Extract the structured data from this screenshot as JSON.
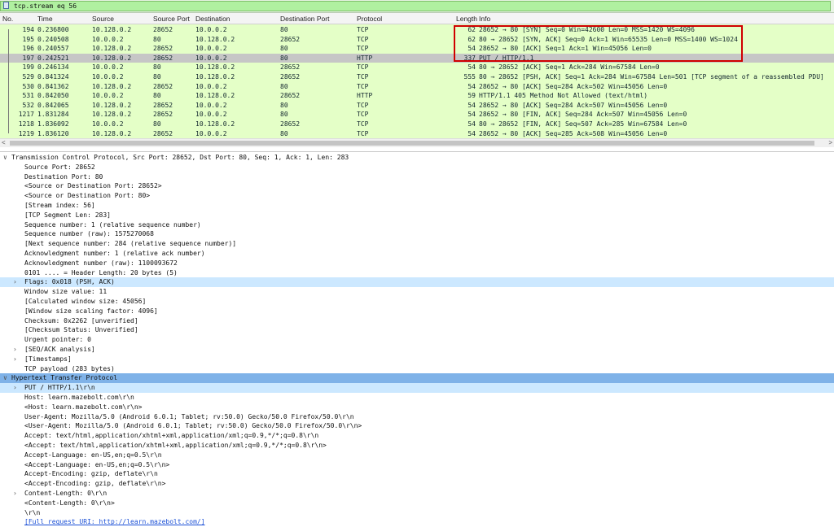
{
  "filter": {
    "value": "tcp.stream eq 56"
  },
  "columns": [
    "No.",
    "Time",
    "Source",
    "Source Port",
    "Destination",
    "Destination Port",
    "Protocol",
    "Length",
    "Info"
  ],
  "packets": [
    {
      "no": "194",
      "time": "0.236800",
      "src": "10.128.0.2",
      "sport": "28652",
      "dst": "10.0.0.2",
      "dport": "80",
      "proto": "TCP",
      "len": "62",
      "info": "28652 → 80 [SYN] Seq=0 Win=42600 Len=0 MSS=1420 WS=4096"
    },
    {
      "no": "195",
      "time": "0.240508",
      "src": "10.0.0.2",
      "sport": "80",
      "dst": "10.128.0.2",
      "dport": "28652",
      "proto": "TCP",
      "len": "62",
      "info": "80 → 28652 [SYN, ACK] Seq=0 Ack=1 Win=65535 Len=0 MSS=1400 WS=1024"
    },
    {
      "no": "196",
      "time": "0.240557",
      "src": "10.128.0.2",
      "sport": "28652",
      "dst": "10.0.0.2",
      "dport": "80",
      "proto": "TCP",
      "len": "54",
      "info": "28652 → 80 [ACK] Seq=1 Ack=1 Win=45056 Len=0"
    },
    {
      "no": "197",
      "time": "0.242521",
      "src": "10.128.0.2",
      "sport": "28652",
      "dst": "10.0.0.2",
      "dport": "80",
      "proto": "HTTP",
      "len": "337",
      "info": "PUT / HTTP/1.1"
    },
    {
      "no": "199",
      "time": "0.246134",
      "src": "10.0.0.2",
      "sport": "80",
      "dst": "10.128.0.2",
      "dport": "28652",
      "proto": "TCP",
      "len": "54",
      "info": "80 → 28652 [ACK] Seq=1 Ack=284 Win=67584 Len=0"
    },
    {
      "no": "529",
      "time": "0.841324",
      "src": "10.0.0.2",
      "sport": "80",
      "dst": "10.128.0.2",
      "dport": "28652",
      "proto": "TCP",
      "len": "555",
      "info": "80 → 28652 [PSH, ACK] Seq=1 Ack=284 Win=67584 Len=501 [TCP segment of a reassembled PDU]"
    },
    {
      "no": "530",
      "time": "0.841362",
      "src": "10.128.0.2",
      "sport": "28652",
      "dst": "10.0.0.2",
      "dport": "80",
      "proto": "TCP",
      "len": "54",
      "info": "28652 → 80 [ACK] Seq=284 Ack=502 Win=45056 Len=0"
    },
    {
      "no": "531",
      "time": "0.842050",
      "src": "10.0.0.2",
      "sport": "80",
      "dst": "10.128.0.2",
      "dport": "28652",
      "proto": "HTTP",
      "len": "59",
      "info": "HTTP/1.1 405 Method Not Allowed  (text/html)"
    },
    {
      "no": "532",
      "time": "0.842065",
      "src": "10.128.0.2",
      "sport": "28652",
      "dst": "10.0.0.2",
      "dport": "80",
      "proto": "TCP",
      "len": "54",
      "info": "28652 → 80 [ACK] Seq=284 Ack=507 Win=45056 Len=0"
    },
    {
      "no": "1217",
      "time": "1.831284",
      "src": "10.128.0.2",
      "sport": "28652",
      "dst": "10.0.0.2",
      "dport": "80",
      "proto": "TCP",
      "len": "54",
      "info": "28652 → 80 [FIN, ACK] Seq=284 Ack=507 Win=45056 Len=0"
    },
    {
      "no": "1218",
      "time": "1.836092",
      "src": "10.0.0.2",
      "sport": "80",
      "dst": "10.128.0.2",
      "dport": "28652",
      "proto": "TCP",
      "len": "54",
      "info": "80 → 28652 [FIN, ACK] Seq=507 Ack=285 Win=67584 Len=0"
    },
    {
      "no": "1219",
      "time": "1.836120",
      "src": "10.128.0.2",
      "sport": "28652",
      "dst": "10.0.0.2",
      "dport": "80",
      "proto": "TCP",
      "len": "54",
      "info": "28652 → 80 [ACK] Seq=285 Ack=508 Win=45056 Len=0"
    }
  ],
  "details": [
    {
      "text": "Transmission Control Protocol, Src Port: 28652, Dst Port: 80, Seq: 1, Ack: 1, Len: 283",
      "indent": 0,
      "expander": "v",
      "style": ""
    },
    {
      "text": "Source Port: 28652",
      "indent": 1,
      "expander": "",
      "style": ""
    },
    {
      "text": "Destination Port: 80",
      "indent": 1,
      "expander": "",
      "style": ""
    },
    {
      "text": "<Source or Destination Port: 28652>",
      "indent": 1,
      "expander": "",
      "style": ""
    },
    {
      "text": "<Source or Destination Port: 80>",
      "indent": 1,
      "expander": "",
      "style": ""
    },
    {
      "text": "[Stream index: 56]",
      "indent": 1,
      "expander": "",
      "style": ""
    },
    {
      "text": "[TCP Segment Len: 283]",
      "indent": 1,
      "expander": "",
      "style": ""
    },
    {
      "text": "Sequence number: 1    (relative sequence number)",
      "indent": 1,
      "expander": "",
      "style": ""
    },
    {
      "text": "Sequence number (raw): 1575270068",
      "indent": 1,
      "expander": "",
      "style": ""
    },
    {
      "text": "[Next sequence number: 284    (relative sequence number)]",
      "indent": 1,
      "expander": "",
      "style": ""
    },
    {
      "text": "Acknowledgment number: 1    (relative ack number)",
      "indent": 1,
      "expander": "",
      "style": ""
    },
    {
      "text": "Acknowledgment number (raw): 1100093672",
      "indent": 1,
      "expander": "",
      "style": ""
    },
    {
      "text": "0101 .... = Header Length: 20 bytes (5)",
      "indent": 1,
      "expander": "",
      "style": ""
    },
    {
      "text": "Flags: 0x018 (PSH, ACK)",
      "indent": 1,
      "expander": ">",
      "style": "hl"
    },
    {
      "text": "Window size value: 11",
      "indent": 1,
      "expander": "",
      "style": ""
    },
    {
      "text": "[Calculated window size: 45056]",
      "indent": 1,
      "expander": "",
      "style": ""
    },
    {
      "text": "[Window size scaling factor: 4096]",
      "indent": 1,
      "expander": "",
      "style": ""
    },
    {
      "text": "Checksum: 0x2262 [unverified]",
      "indent": 1,
      "expander": "",
      "style": ""
    },
    {
      "text": "[Checksum Status: Unverified]",
      "indent": 1,
      "expander": "",
      "style": ""
    },
    {
      "text": "Urgent pointer: 0",
      "indent": 1,
      "expander": "",
      "style": ""
    },
    {
      "text": "[SEQ/ACK analysis]",
      "indent": 1,
      "expander": ">",
      "style": ""
    },
    {
      "text": "[Timestamps]",
      "indent": 1,
      "expander": ">",
      "style": ""
    },
    {
      "text": "TCP payload (283 bytes)",
      "indent": 1,
      "expander": "",
      "style": ""
    },
    {
      "text": "Hypertext Transfer Protocol",
      "indent": 0,
      "expander": "v",
      "style": "hl2"
    },
    {
      "text": "PUT / HTTP/1.1\\r\\n",
      "indent": 1,
      "expander": ">",
      "style": "hl"
    },
    {
      "text": "Host: learn.mazebolt.com\\r\\n",
      "indent": 1,
      "expander": "",
      "style": ""
    },
    {
      "text": "<Host: learn.mazebolt.com\\r\\n>",
      "indent": 1,
      "expander": "",
      "style": ""
    },
    {
      "text": "User-Agent: Mozilla/5.0 (Android 6.0.1; Tablet; rv:50.0) Gecko/50.0 Firefox/50.0\\r\\n",
      "indent": 1,
      "expander": "",
      "style": ""
    },
    {
      "text": "<User-Agent: Mozilla/5.0 (Android 6.0.1; Tablet; rv:50.0) Gecko/50.0 Firefox/50.0\\r\\n>",
      "indent": 1,
      "expander": "",
      "style": ""
    },
    {
      "text": "Accept: text/html,application/xhtml+xml,application/xml;q=0.9,*/*;q=0.8\\r\\n",
      "indent": 1,
      "expander": "",
      "style": ""
    },
    {
      "text": "<Accept: text/html,application/xhtml+xml,application/xml;q=0.9,*/*;q=0.8\\r\\n>",
      "indent": 1,
      "expander": "",
      "style": ""
    },
    {
      "text": "Accept-Language: en-US,en;q=0.5\\r\\n",
      "indent": 1,
      "expander": "",
      "style": ""
    },
    {
      "text": "<Accept-Language: en-US,en;q=0.5\\r\\n>",
      "indent": 1,
      "expander": "",
      "style": ""
    },
    {
      "text": "Accept-Encoding: gzip, deflate\\r\\n",
      "indent": 1,
      "expander": "",
      "style": ""
    },
    {
      "text": "<Accept-Encoding: gzip, deflate\\r\\n>",
      "indent": 1,
      "expander": "",
      "style": ""
    },
    {
      "text": "Content-Length: 0\\r\\n",
      "indent": 1,
      "expander": ">",
      "style": ""
    },
    {
      "text": "<Content-Length: 0\\r\\n>",
      "indent": 1,
      "expander": "",
      "style": ""
    },
    {
      "text": "\\r\\n",
      "indent": 1,
      "expander": "",
      "style": ""
    },
    {
      "text": "[Full request URI: http://learn.mazebolt.com/]",
      "indent": 1,
      "expander": "",
      "style": "link"
    }
  ],
  "colors": {
    "filter_ok": "#b0f0a0",
    "tcp_row": "#e4ffc7",
    "selected_row": "#c6c6c6",
    "highlight": "#cce8ff",
    "section_highlight": "#7fb2e8",
    "annotation": "#d00000"
  }
}
